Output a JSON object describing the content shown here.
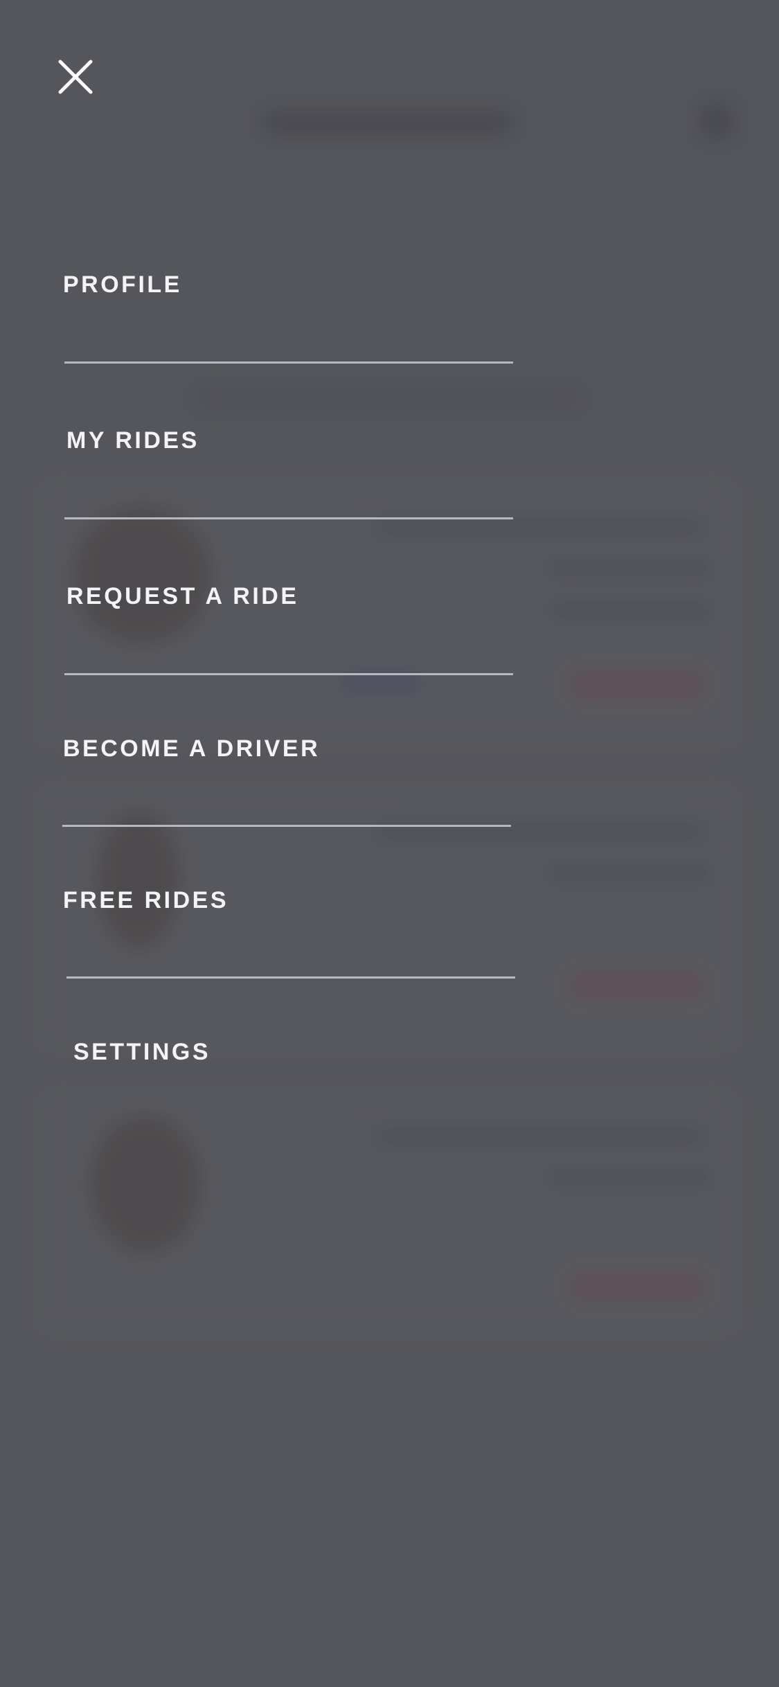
{
  "menu": {
    "items": [
      {
        "label": "PROFILE"
      },
      {
        "label": "MY RIDES"
      },
      {
        "label": "REQUEST A RIDE"
      },
      {
        "label": "BECOME A DRIVER"
      },
      {
        "label": "FREE RIDES"
      },
      {
        "label": "SETTINGS"
      }
    ]
  },
  "icons": {
    "close": "close-icon"
  },
  "colors": {
    "overlay": "#55565b",
    "text": "#f4f4f6",
    "divider": "#b8b9c0"
  }
}
